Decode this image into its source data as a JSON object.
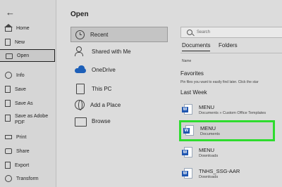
{
  "leftnav": {
    "back_icon": "back-arrow-icon",
    "items": [
      {
        "label": "Home",
        "icon": "home-icon"
      },
      {
        "label": "New",
        "icon": "new-document-icon"
      },
      {
        "label": "Open",
        "icon": "folder-open-icon"
      },
      {
        "label": "Info",
        "icon": "info-icon"
      },
      {
        "label": "Save",
        "icon": "save-icon"
      },
      {
        "label": "Save As",
        "icon": "save-as-icon"
      },
      {
        "label": "Save as Adobe PDF",
        "icon": "adobe-pdf-icon"
      },
      {
        "label": "Print",
        "icon": "print-icon"
      },
      {
        "label": "Share",
        "icon": "share-icon"
      },
      {
        "label": "Export",
        "icon": "export-icon"
      },
      {
        "label": "Transform",
        "icon": "transform-icon"
      }
    ]
  },
  "main": {
    "title": "Open",
    "locations": [
      {
        "label": "Recent",
        "icon": "clock-icon"
      },
      {
        "label": "Shared with Me",
        "icon": "people-icon"
      },
      {
        "label": "OneDrive",
        "icon": "onedrive-cloud-icon"
      },
      {
        "label": "This PC",
        "icon": "computer-icon"
      },
      {
        "label": "Add a Place",
        "icon": "globe-icon"
      },
      {
        "label": "Browse",
        "icon": "folder-icon"
      }
    ],
    "search": {
      "placeholder": "Search"
    },
    "tabs": [
      {
        "label": "Documents",
        "active": true
      },
      {
        "label": "Folders",
        "active": false
      }
    ],
    "column_header": "Name",
    "favorites": {
      "title": "Favorites",
      "hint": "Pin files you want to easily find later. Click the star"
    },
    "last_week": {
      "title": "Last Week",
      "files": [
        {
          "name": "MENU",
          "path": "Documents » Custom Office Templates",
          "highlighted": false
        },
        {
          "name": "MENU",
          "path": "Documents",
          "highlighted": true
        },
        {
          "name": "MENU",
          "path": "Downloads",
          "highlighted": false
        },
        {
          "name": "TNHS_SSG-AAR",
          "path": "Downloads",
          "highlighted": false
        }
      ]
    },
    "highlight_color": "#2edc2e",
    "word_badge_color": "#1f56b0",
    "word_badge_letter": "W"
  }
}
